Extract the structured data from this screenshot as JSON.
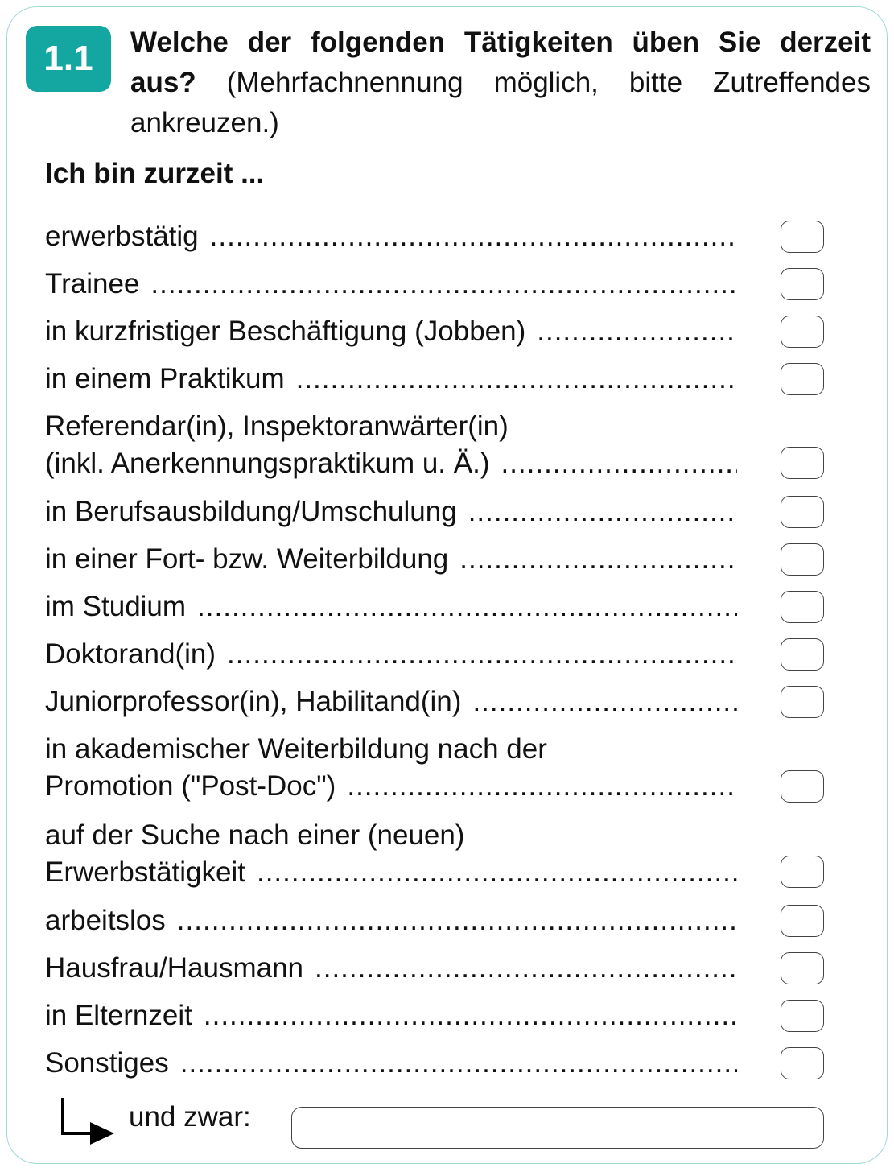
{
  "question": {
    "number": "1.1",
    "title_bold": "Welche der folgenden Tätigkeiten üben Sie derzeit aus?",
    "title_normal": "(Mehrfachnennung möglich, bitte Zutreffendes ankreuzen.)"
  },
  "subheading": "Ich bin zurzeit ...",
  "options": [
    {
      "line1": "erwerbstätig"
    },
    {
      "line1": "Trainee"
    },
    {
      "line1": "in kurzfristiger Beschäftigung (Jobben)"
    },
    {
      "line1": "in einem Praktikum"
    },
    {
      "line1": "Referendar(in), Inspektoranwärter(in)",
      "line2": "(inkl. Anerkennungspraktikum u. Ä.)"
    },
    {
      "line1": "in Berufsausbildung/Umschulung"
    },
    {
      "line1": "in einer Fort- bzw. Weiterbildung"
    },
    {
      "line1": "im Studium"
    },
    {
      "line1": "Doktorand(in)"
    },
    {
      "line1": "Juniorprofessor(in), Habilitand(in)"
    },
    {
      "line1": "in akademischer Weiterbildung nach der",
      "line2": "Promotion (\"Post-Doc\")"
    },
    {
      "line1": "auf der Suche nach einer (neuen)",
      "line2": "Erwerbstätigkeit"
    },
    {
      "line1": "arbeitslos"
    },
    {
      "line1": "Hausfrau/Hausmann"
    },
    {
      "line1": "in Elternzeit"
    },
    {
      "line1": "Sonstiges"
    }
  ],
  "other": {
    "label": "und zwar:",
    "value": ""
  },
  "colors": {
    "accent": "#14a7a1",
    "card_border": "#9fd9d6"
  },
  "icons": {
    "other_arrow": "arrow-down-right-icon"
  }
}
